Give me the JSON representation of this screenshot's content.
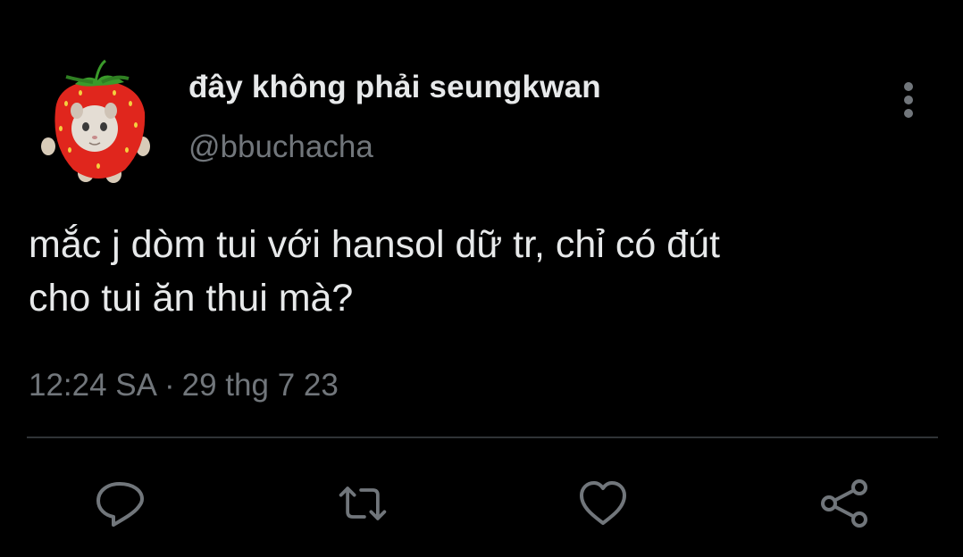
{
  "tweet": {
    "display_name": "đây không phải seungkwan",
    "handle": "@bbuchacha",
    "text": "mắc j dòm tui với hansol dữ tr, chỉ có đút\ncho tui ăn thui mà?",
    "time": "12:24 SA",
    "separator": "·",
    "date": "29 thg 7 23",
    "avatar": "strawberry-cat-avatar"
  },
  "actions": [
    {
      "icon": "reply-icon"
    },
    {
      "icon": "retweet-icon"
    },
    {
      "icon": "like-icon"
    },
    {
      "icon": "share-icon"
    }
  ],
  "colors": {
    "background": "#000000",
    "primary_text": "#e7e9ea",
    "secondary_text": "#71767b",
    "divider": "#2f3336",
    "strawberry_red": "#e0261d",
    "leaf_green": "#3a9a2a"
  }
}
